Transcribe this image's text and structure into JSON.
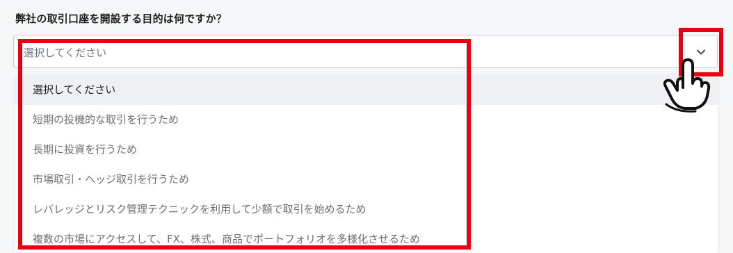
{
  "form": {
    "question": "弊社の取引口座を開設する目的は何ですか？",
    "select": {
      "current_value": "選択してください",
      "toggle_icon": "chevron-down-icon",
      "options": [
        {
          "label": "選択してください",
          "selected": true
        },
        {
          "label": "短期の投機的な取引を行うため",
          "selected": false
        },
        {
          "label": "長期に投資を行うため",
          "selected": false
        },
        {
          "label": "市場取引・ヘッジ取引を行うため",
          "selected": false
        },
        {
          "label": "レバレッジとリスク管理テクニックを利用して少額で取引を始めるため",
          "selected": false
        },
        {
          "label": "複数の市場にアクセスして、FX、株式、商品でポートフォリオを多様化させるため",
          "selected": false
        }
      ]
    }
  },
  "annotations": {
    "highlight_color": "#e60012",
    "cursor_icon": "hand-pointer-icon"
  },
  "colors": {
    "background": "#f5f7f9",
    "selected_option_bg": "#eef0f3",
    "border": "#c3ccd6"
  }
}
